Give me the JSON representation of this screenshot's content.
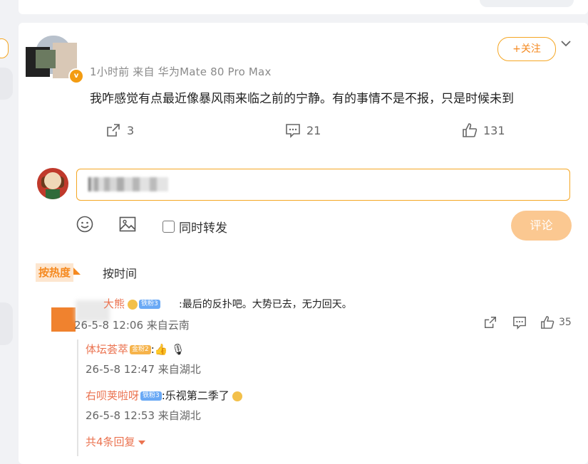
{
  "post": {
    "meta": "1小时前 来自 华为Mate 80 Pro Max",
    "follow_label": "+关注",
    "text": "我咋感觉有点最近像暴风雨来临之前的宁静。有的事情不是不报，只是时候未到",
    "reposts": "3",
    "comments": "21",
    "likes": "131"
  },
  "composer": {
    "placeholder": "",
    "repost_label": "同时转发",
    "submit_label": "评论"
  },
  "sort": {
    "hot": "按热度",
    "time": "按时间"
  },
  "comment": {
    "user": "大熊",
    "fan_badge": "铁粉3",
    "text": ":最后的反扑吧。大势已去，无力回天。",
    "time": "26-5-8 12:06 来自云南",
    "likes": "35",
    "replies": [
      {
        "user": "体坛荟萃",
        "badge": "金粉2",
        "text": ":👍 🎙",
        "time": "26-5-8 12:47 来自湖北"
      },
      {
        "user": "右呗荚啦呀",
        "badge": "铁粉3",
        "text": ":乐视第二季了",
        "time": "26-5-8 12:53 来自湖北"
      }
    ],
    "more_label": "共4条回复"
  },
  "icons": [
    "repost-icon",
    "comment-icon",
    "like-icon",
    "emoji-icon",
    "image-icon",
    "chevron-down-icon",
    "verified-icon"
  ],
  "colors": {
    "accent": "#f5891f",
    "name": "#eb7350",
    "submit_disabled": "#fbc891"
  }
}
